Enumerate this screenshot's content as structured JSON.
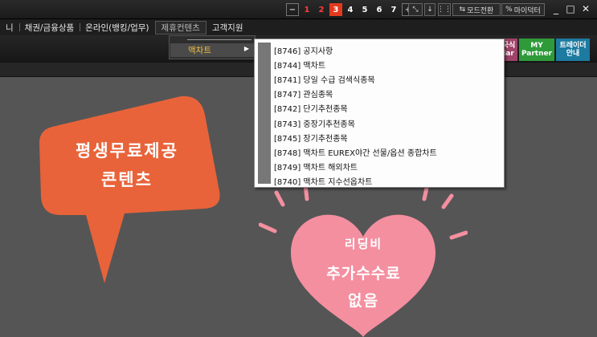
{
  "window_controls": {
    "minus": "−",
    "numbers": [
      "1",
      "2",
      "3",
      "4",
      "5",
      "6",
      "7"
    ],
    "active_number": "3",
    "plus": "+",
    "mode_button": "모드전환",
    "mydesk_button": "마이덕터",
    "minimize": "_",
    "maximize": "□",
    "close": "✕"
  },
  "menubar": {
    "items": [
      "니",
      "채권/금융상품",
      "온라인(뱅킹/업무)",
      "제휴컨텐츠",
      "고객지원"
    ]
  },
  "toolbar": {
    "partial_left": "국식",
    "partial_left2": "lar",
    "my_partner_line1": "MY",
    "my_partner_line2": "Partner",
    "trader_guide_line1": "트레이더",
    "trader_guide_line2": "안내",
    "colors": {
      "blue": "#2f5ea8",
      "pink": "#b14a6e",
      "green": "#2f9a3a",
      "teal": "#1d7aa0"
    }
  },
  "submenu_level1": {
    "item": "맥차트",
    "arrow": "▶"
  },
  "submenu_level2": {
    "items": [
      "[8746] 공지사항",
      "[8744] 맥차트",
      "[8741] 당일 수급 검색식종목",
      "[8747] 관심종목",
      "[8742] 단기추천종목",
      "[8743] 중장기추천종목",
      "[8745] 장기추천종목",
      "[8748] 맥차트 EUREX야간 선물/옵션 종합차트",
      "[8749] 맥차트 해외차트",
      "[8740] 맥차트 지수선옵차트"
    ]
  },
  "promo": {
    "bubble_line1": "평생무료제공",
    "bubble_line2": "콘텐츠",
    "heart_line1": "리딩비",
    "heart_line2": "추가수수료",
    "heart_line3": "없음",
    "bubble_color": "#e8633a",
    "heart_color": "#f48fa0"
  }
}
